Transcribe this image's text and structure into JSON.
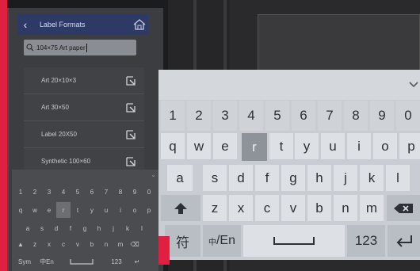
{
  "header": {
    "title": "Label Formats"
  },
  "search": {
    "value": "104×75 Art paper"
  },
  "list": [
    {
      "label": "Art 20×10×3"
    },
    {
      "label": "Art 30×50"
    },
    {
      "label": "Label 20X50"
    },
    {
      "label": "Synthetic 100×60"
    }
  ],
  "small_keyboard": {
    "row1": [
      "1",
      "2",
      "3",
      "4",
      "5",
      "6",
      "7",
      "8",
      "9",
      "0"
    ],
    "row2": [
      "q",
      "w",
      "e",
      "r",
      "t",
      "y",
      "u",
      "i",
      "o",
      "p"
    ],
    "row3": [
      "a",
      "s",
      "d",
      "f",
      "g",
      "h",
      "j",
      "k",
      "l"
    ],
    "row4": [
      "z",
      "x",
      "c",
      "v",
      "b",
      "n",
      "m"
    ],
    "sym": "Sym",
    "lang": "中En",
    "num": "123"
  },
  "keyboard": {
    "row1": [
      "1",
      "2",
      "3",
      "4",
      "5",
      "6",
      "7",
      "8",
      "9",
      "0"
    ],
    "row2": [
      "q",
      "w",
      "e",
      "r",
      "t",
      "y",
      "u",
      "i",
      "o",
      "p"
    ],
    "row3": [
      "a",
      "s",
      "d",
      "f",
      "g",
      "h",
      "j",
      "k",
      "l"
    ],
    "row4": [
      "z",
      "x",
      "c",
      "v",
      "b",
      "n",
      "m"
    ],
    "sym": "符",
    "lang_small": "中",
    "lang_big": "/En",
    "num": "123",
    "selected_key": "r"
  },
  "colors": {
    "accent_red": "#e02040",
    "header_blue": "#2d3a66"
  }
}
